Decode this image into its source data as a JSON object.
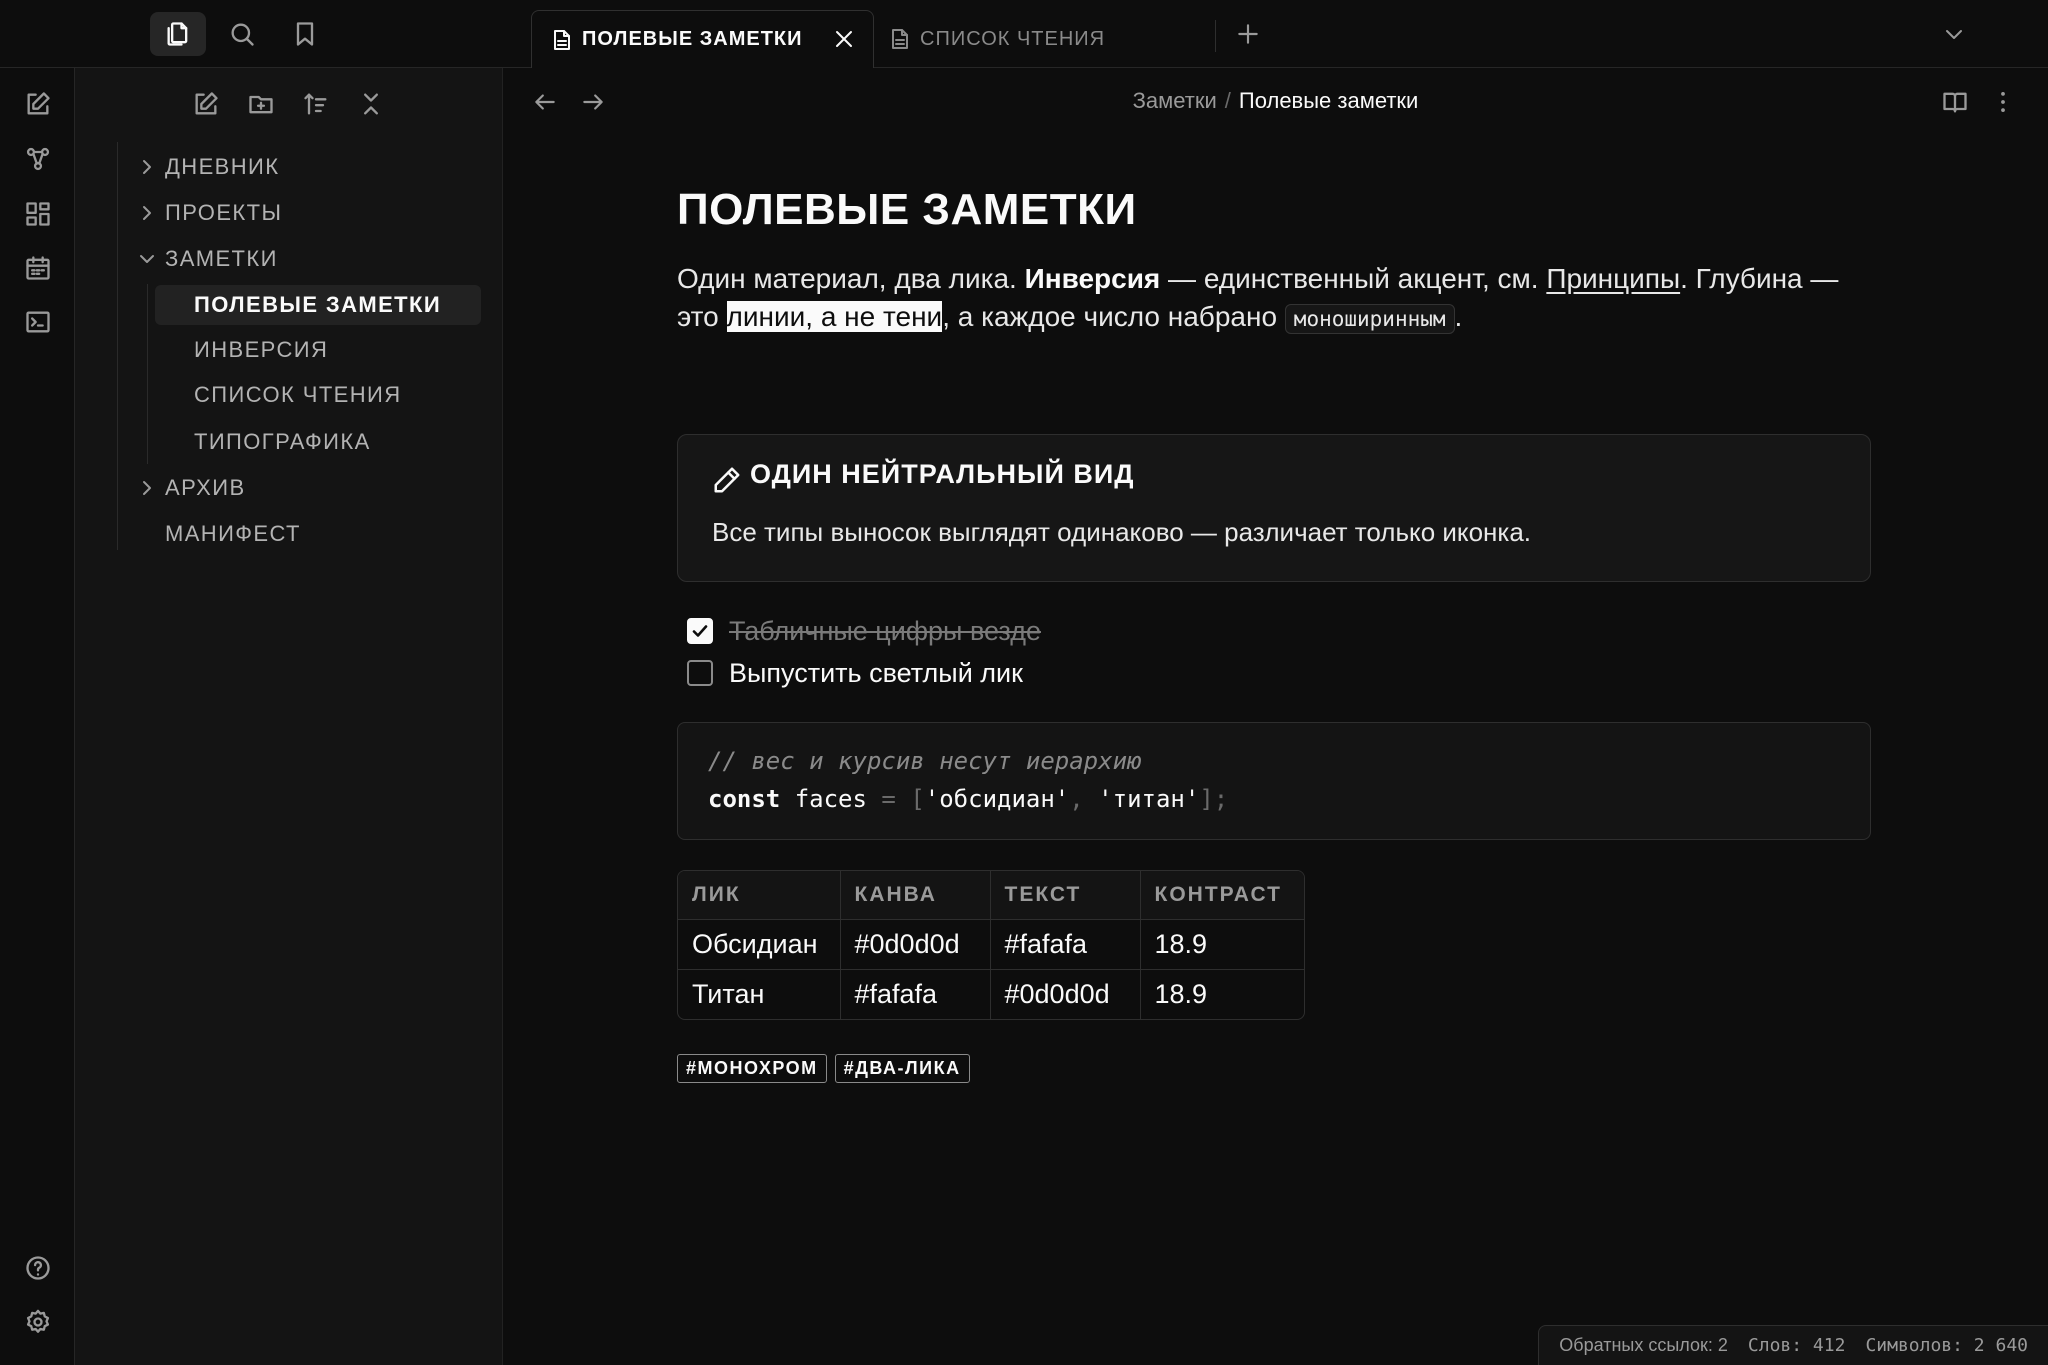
{
  "tabs": [
    {
      "label": "ПОЛЕВЫЕ ЗАМЕТКИ",
      "active": true
    },
    {
      "label": "СПИСОК ЧТЕНИЯ",
      "active": false
    }
  ],
  "titlebar_icons": [
    "files-icon",
    "search-icon",
    "bookmark-icon"
  ],
  "ribbon_icons": [
    "new-note-icon",
    "graph-icon",
    "grid-icon",
    "calendar-icon",
    "terminal-icon",
    "help-icon",
    "settings-icon"
  ],
  "sidebar_tools": [
    "new-note-icon",
    "new-folder-icon",
    "sort-icon",
    "collapse-icon"
  ],
  "tree": {
    "diary": "ДНЕВНИК",
    "projects": "ПРОЕКТЫ",
    "notes": "ЗАМЕТКИ",
    "notes_children": [
      "ПОЛЕВЫЕ ЗАМЕТКИ",
      "ИНВЕРСИЯ",
      "СПИСОК ЧТЕНИЯ",
      "ТИПОГРАФИКА"
    ],
    "archive": "АРХИВ",
    "manifesto": "МАНИФЕСТ"
  },
  "breadcrumb": {
    "parent": "Заметки",
    "separator": "/",
    "current": "Полевые заметки"
  },
  "note": {
    "title": "ПОЛЕВЫЕ ЗАМЕТКИ",
    "para": {
      "t1": "Один материал, два лика. ",
      "bold": "Инверсия",
      "t2": " — единственный акцент, см. ",
      "link": "Принципы",
      "t3": ". Глубина — это ",
      "highlight": "линии, а не тени",
      "t4": ", а каждое число набрано ",
      "code": "моноширинным",
      "t5": "."
    },
    "callout": {
      "title": "ОДИН НЕЙТРАЛЬНЫЙ ВИД",
      "body": "Все типы выносок выглядят одинаково — различает только иконка.",
      "icon": "pencil-icon"
    },
    "tasks": [
      {
        "text": "Табличные цифры везде",
        "done": true
      },
      {
        "text": "Выпустить светлый лик",
        "done": false
      }
    ],
    "code": {
      "comment": "// вес и курсив несут иерархию",
      "keyword": "const",
      "ident": " faces ",
      "eq": "= ",
      "open": "[",
      "s1": "'обсидиан'",
      "comma": ", ",
      "s2": "'титан'",
      "close": "];"
    },
    "table": {
      "headers": [
        "ЛИК",
        "КАНВА",
        "ТЕКСТ",
        "КОНТРАСТ"
      ],
      "rows": [
        [
          "Обсидиан",
          "#0d0d0d",
          "#fafafa",
          "18.9"
        ],
        [
          "Титан",
          "#fafafa",
          "#0d0d0d",
          "18.9"
        ]
      ]
    },
    "tags": [
      "#МОНОХРОМ",
      "#ДВА-ЛИКА"
    ]
  },
  "status": {
    "backlinks": "Обратных ссылок: 2",
    "words": "Слов: 412",
    "chars": "Символов: 2 640"
  },
  "colors": {
    "canvas": "#0d0d0d",
    "text": "#fafafa",
    "sidebar": "#141414"
  }
}
